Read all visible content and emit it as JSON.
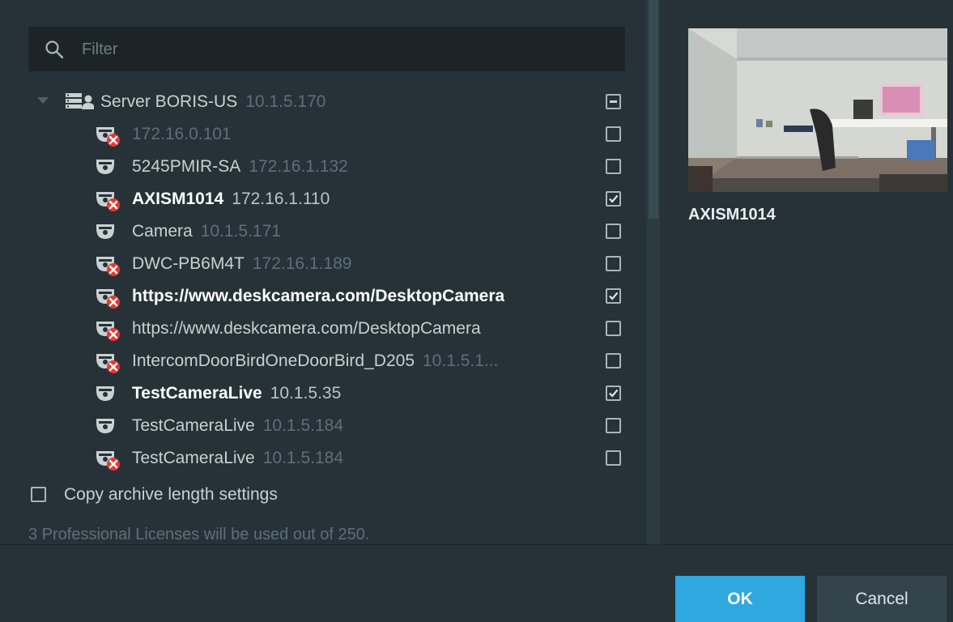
{
  "filter": {
    "placeholder": "Filter",
    "value": ""
  },
  "server": {
    "name": "Server BORIS-US",
    "address": "10.1.5.170",
    "state": "partial"
  },
  "devices": [
    {
      "name": "",
      "address": "172.16.0.101",
      "status": "offline",
      "checked": false,
      "nameAddr": "172.16.0.101"
    },
    {
      "name": "5245PMIR-SA",
      "address": "172.16.1.132",
      "status": "online",
      "checked": false
    },
    {
      "name": "AXISM1014",
      "address": "172.16.1.110",
      "status": "offline",
      "checked": true
    },
    {
      "name": "Camera",
      "address": "10.1.5.171",
      "status": "online",
      "checked": false
    },
    {
      "name": "DWC-PB6M4T",
      "address": "172.16.1.189",
      "status": "offline",
      "checked": false
    },
    {
      "name": "https://www.deskcamera.com/DesktopCamera",
      "address": "",
      "status": "offline",
      "checked": true
    },
    {
      "name": "https://www.deskcamera.com/DesktopCamera",
      "address": "",
      "status": "offline",
      "checked": false
    },
    {
      "name": "IntercomDoorBirdOneDoorBird_D205",
      "address": "10.1.5.1...",
      "status": "offline",
      "checked": false
    },
    {
      "name": "TestCameraLive",
      "address": "10.1.5.35",
      "status": "online",
      "checked": true
    },
    {
      "name": "TestCameraLive",
      "address": "10.1.5.184",
      "status": "online",
      "checked": false
    },
    {
      "name": "TestCameraLive",
      "address": "10.1.5.184",
      "status": "offline",
      "checked": false
    }
  ],
  "copy_archive": {
    "label": "Copy archive length settings",
    "checked": false
  },
  "license_text": "3 Professional Licenses will be used out of 250.",
  "preview": {
    "camera_name": "AXISM1014"
  },
  "buttons": {
    "ok": "OK",
    "cancel": "Cancel"
  },
  "colors": {
    "accent": "#2fa8e0",
    "offline_badge": "#e53935",
    "background": "#263238"
  }
}
